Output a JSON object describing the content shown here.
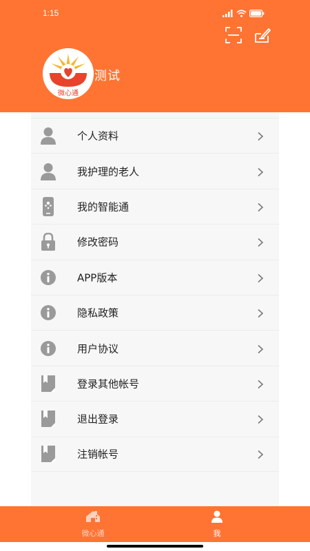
{
  "status_bar": {
    "time": "1:15",
    "battery": "100"
  },
  "header": {
    "username": "测试",
    "logo_text": "微心通",
    "scan_icon": "scan-icon",
    "edit_icon": "edit-icon"
  },
  "menu": {
    "items": [
      {
        "label": "个人资料",
        "icon": "user-icon"
      },
      {
        "label": "我护理的老人",
        "icon": "user-icon"
      },
      {
        "label": "我的智能通",
        "icon": "device-icon"
      },
      {
        "label": "修改密码",
        "icon": "lock-icon"
      },
      {
        "label": "APP版本",
        "icon": "info-icon"
      },
      {
        "label": "隐私政策",
        "icon": "info-icon"
      },
      {
        "label": "用户协议",
        "icon": "info-icon"
      },
      {
        "label": "登录其他帐号",
        "icon": "book-icon"
      },
      {
        "label": "退出登录",
        "icon": "book-icon"
      },
      {
        "label": "注销帐号",
        "icon": "book-icon"
      }
    ]
  },
  "tabbar": {
    "home_label": "微心通",
    "me_label": "我",
    "active": "我"
  },
  "colors": {
    "accent": "#ff7433",
    "icon_gray": "#9a9a9a",
    "panel_bg": "#f7f7f7"
  }
}
